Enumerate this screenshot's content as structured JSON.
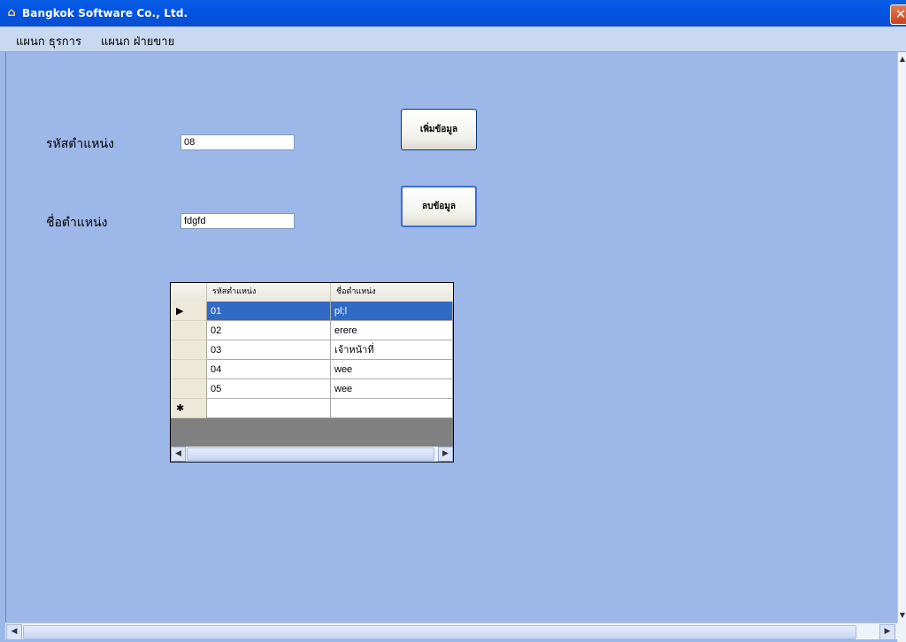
{
  "window": {
    "title": "Bangkok Software Co., Ltd.",
    "close_glyph": "✕",
    "icon": "app-icon"
  },
  "menu": [
    {
      "label": "แผนก ธุรการ"
    },
    {
      "label": "แผนก ฝ่ายขาย"
    }
  ],
  "form": {
    "code_label": "รหัสตำแหน่ง",
    "code_value": "08",
    "name_label": "ชื่อตำแหน่ง",
    "name_value": "fdgfd",
    "add_button": "เพิ่มข้อมูล",
    "delete_button": "ลบข้อมูล"
  },
  "grid": {
    "columns": [
      "รหัสตำแหน่ง",
      "ชื่อตำแหน่ง"
    ],
    "rows": [
      {
        "code": "01",
        "name": "pl;l",
        "selected": true
      },
      {
        "code": "02",
        "name": "erere"
      },
      {
        "code": "03",
        "name": "เจ้าหน้าที่"
      },
      {
        "code": "04",
        "name": "wee"
      },
      {
        "code": "05",
        "name": "wee"
      }
    ],
    "current_row_marker": "▶",
    "new_row_marker": "✱"
  },
  "colors": {
    "client_bg": "#9db7e8",
    "selection": "#316ac5",
    "titlebar": "#0054e3"
  }
}
